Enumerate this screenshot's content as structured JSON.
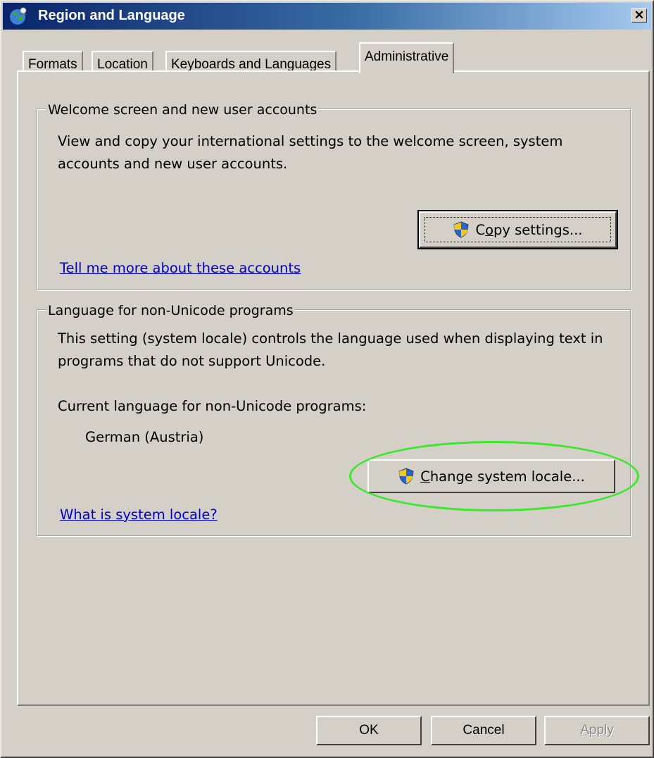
{
  "window": {
    "title": "Region and Language",
    "close_label": "✕"
  },
  "tabs": [
    {
      "label": "Formats",
      "active": false
    },
    {
      "label": "Location",
      "active": false
    },
    {
      "label": "Keyboards and Languages",
      "active": false
    },
    {
      "label": "Administrative",
      "active": true
    }
  ],
  "welcome_group": {
    "title": "Welcome screen and new user accounts",
    "description": "View and copy your international settings to the welcome screen, system accounts and new user accounts.",
    "copy_button_pre": "C",
    "copy_button_mnemonic": "o",
    "copy_button_post": "py settings...",
    "link": "Tell me more about these accounts"
  },
  "locale_group": {
    "title": "Language for non-Unicode programs",
    "description": "This setting (system locale) controls the language used when displaying text in programs that do not support Unicode.",
    "current_label": "Current language for non-Unicode programs:",
    "current_value": "German (Austria)",
    "change_button_mnemonic": "C",
    "change_button_post": "hange system locale...",
    "link": "What is system locale?"
  },
  "footer": {
    "ok": "OK",
    "cancel": "Cancel",
    "apply": "Apply"
  },
  "colors": {
    "highlight": "#39e82c",
    "link": "#0000cc",
    "titlebar_start": "#0a246a"
  }
}
